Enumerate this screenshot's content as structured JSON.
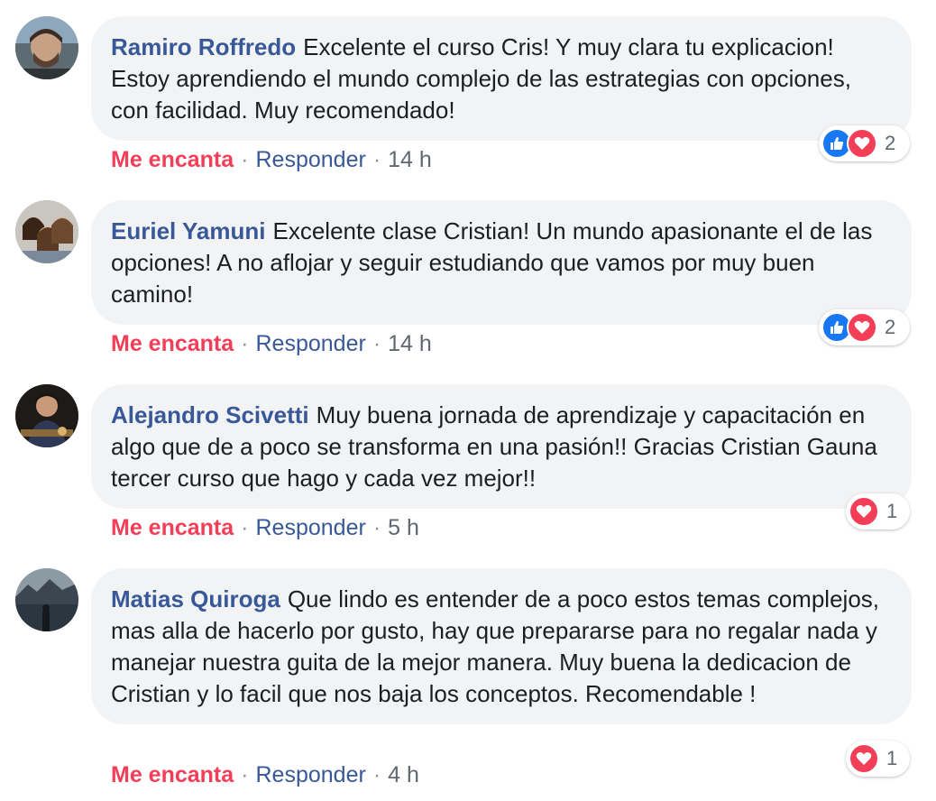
{
  "comments": [
    {
      "author": "Ramiro Roffredo",
      "text": "Excelente el curso Cris! Y muy clara tu explicacion! Estoy aprendiendo el mundo complejo de las estrategias con opciones, con facilidad. Muy recomendado!",
      "love_label": "Me encanta",
      "reply_label": "Responder",
      "time": "14 h",
      "reaction_count": "2",
      "reactions": [
        "like-icon",
        "heart-icon"
      ]
    },
    {
      "author": "Euriel Yamuni",
      "text": "Excelente clase Cristian! Un mundo apasionante el de las opciones! A no aflojar y seguir estudiando que vamos por muy buen camino!",
      "love_label": "Me encanta",
      "reply_label": "Responder",
      "time": "14 h",
      "reaction_count": "2",
      "reactions": [
        "like-icon",
        "heart-icon"
      ]
    },
    {
      "author": "Alejandro Scivetti",
      "text": "Muy buena jornada de aprendizaje y capacitación en algo que de a poco se transforma en una pasión!! Gracias Cristian Gauna tercer curso que hago y cada vez mejor!!",
      "love_label": "Me encanta",
      "reply_label": "Responder",
      "time": "5 h",
      "reaction_count": "1",
      "reactions": [
        "heart-icon"
      ]
    },
    {
      "author": "Matias Quiroga",
      "text": "Que lindo es entender de a poco estos temas complejos, mas alla de hacerlo por gusto, hay que prepararse para no regalar nada y manejar nuestra guita de la mejor manera. Muy buena la dedicacion de Cristian y lo facil que nos baja los conceptos. Recomendable !",
      "love_label": "Me encanta",
      "reply_label": "Responder",
      "time": "4 h",
      "reaction_count": "1",
      "reactions": [
        "heart-icon"
      ]
    }
  ],
  "separator": "·",
  "colors": {
    "author": "#385898",
    "love": "#f33e58",
    "like": "#1877f2",
    "bubble": "#f2f3f5"
  }
}
